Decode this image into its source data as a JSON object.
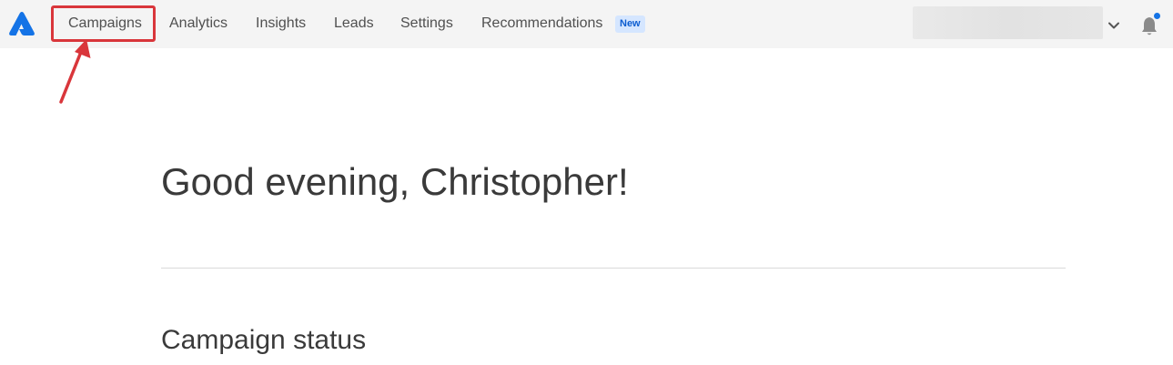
{
  "nav": {
    "items": [
      {
        "label": "Campaigns"
      },
      {
        "label": "Analytics"
      },
      {
        "label": "Insights"
      },
      {
        "label": "Leads"
      },
      {
        "label": "Settings"
      },
      {
        "label": "Recommendations"
      }
    ],
    "new_badge": "New",
    "icons": {
      "logo": "triangle-logo-icon",
      "account_menu": "chevron-down-icon",
      "notifications": "bell-icon"
    }
  },
  "main": {
    "greeting": "Good evening, Christopher!",
    "section_title": "Campaign status"
  },
  "annotation": {
    "highlight_color": "#d9363b"
  },
  "colors": {
    "brand_blue": "#1473e6",
    "nav_background": "#f4f4f4",
    "badge_background": "#d5e6ff",
    "badge_text": "#0c5dd0",
    "notification_dot": "#1473e6"
  }
}
